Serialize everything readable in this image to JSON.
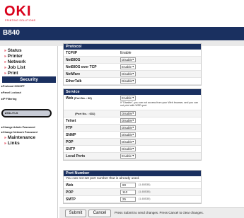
{
  "header": {
    "logo": "OKI",
    "logo_sub": "PRINTING SOLUTIONS",
    "model": "B840"
  },
  "sidebar": {
    "items": [
      {
        "label": "Status"
      },
      {
        "label": "Printer"
      },
      {
        "label": "Network"
      },
      {
        "label": "Job List"
      },
      {
        "label": "Print"
      }
    ],
    "security_label": "Security",
    "sub_items": [
      {
        "label": "▸Protocol ON/OFF"
      },
      {
        "label": "▸Panel Lockout"
      },
      {
        "label": "▸IP Filtering"
      },
      {
        "label": "▸SSL/TLS"
      },
      {
        "label": "▸Change Admin Password"
      },
      {
        "label": "▸Change Network Password"
      }
    ],
    "bottom_items": [
      {
        "label": "Maintenance"
      },
      {
        "label": "Links"
      }
    ]
  },
  "protocol": {
    "title": "Protocol",
    "rows": [
      {
        "label": "TCP/IP",
        "value": "Enable",
        "type": "text"
      },
      {
        "label": "NetBIOS",
        "value": "Disable",
        "type": "select"
      },
      {
        "label": "NetBIOS over TCP",
        "value": "Enable",
        "type": "select"
      },
      {
        "label": "NetWare",
        "value": "Disable",
        "type": "select"
      },
      {
        "label": "EtherTalk",
        "value": "Disable",
        "type": "select"
      }
    ]
  },
  "service": {
    "title": "Service",
    "web": {
      "label": "Web",
      "port_note": "(Port No. : 80)",
      "value": "Enable",
      "note": "If \"Disable\", you can not access from your Web browser, and you can not print with WSD-port."
    },
    "ipps": {
      "label": "(Port No. : 631)",
      "value": "Disable"
    },
    "rows": [
      {
        "label": "Telnet",
        "value": "Disable"
      },
      {
        "label": "FTP",
        "value": "Disable"
      },
      {
        "label": "SNMP",
        "value": "Disable"
      },
      {
        "label": "POP",
        "value": "Disable"
      },
      {
        "label": "SNTP",
        "value": "Disable"
      },
      {
        "label": "Local Ports",
        "value": "Enable"
      }
    ]
  },
  "port_number": {
    "title": "Port Number",
    "info": "You can not set port number that is already used.",
    "rows": [
      {
        "label": "Web",
        "value": "80",
        "range": "(1-65535)"
      },
      {
        "label": "POP",
        "value": "110",
        "range": "(1-65535)"
      },
      {
        "label": "SMTP",
        "value": "25",
        "range": "(1-65535)"
      }
    ]
  },
  "footer": {
    "submit": "Submit",
    "cancel": "Cancel",
    "hint": "Press Submit to send changes. Press Cancel to clear changes."
  },
  "colors": {
    "brand_red": "#d9001b",
    "navy": "#1a3060"
  }
}
